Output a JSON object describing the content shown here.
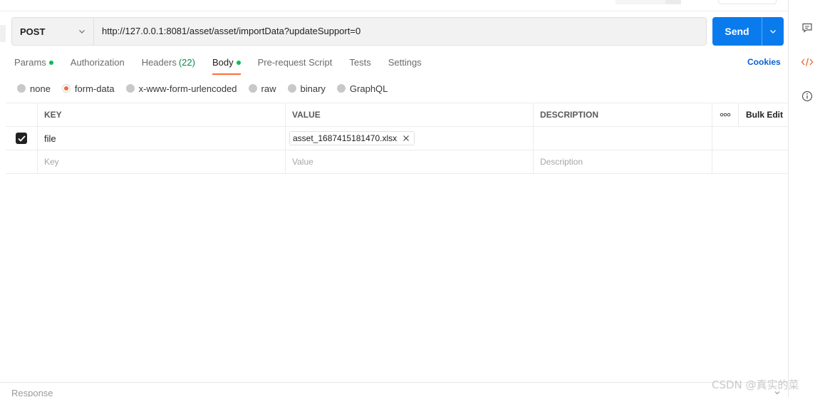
{
  "request": {
    "method": "POST",
    "url": "http://127.0.0.1:8081/asset/asset/importData?updateSupport=0",
    "send_label": "Send"
  },
  "tabs": {
    "items": [
      {
        "label": "Params",
        "dot": true
      },
      {
        "label": "Authorization"
      },
      {
        "label": "Headers",
        "count": "(22)"
      },
      {
        "label": "Body",
        "dot": true,
        "active": true
      },
      {
        "label": "Pre-request Script"
      },
      {
        "label": "Tests"
      },
      {
        "label": "Settings"
      }
    ],
    "cookies_label": "Cookies"
  },
  "body_types": {
    "options": [
      "none",
      "form-data",
      "x-www-form-urlencoded",
      "raw",
      "binary",
      "GraphQL"
    ],
    "selected": "form-data"
  },
  "table": {
    "headers": {
      "key": "KEY",
      "value": "VALUE",
      "description": "DESCRIPTION",
      "bulk_edit": "Bulk Edit"
    },
    "rows": [
      {
        "key": "file",
        "value_file": "asset_1687415181470.xlsx",
        "description": "",
        "checked": true
      }
    ],
    "placeholders": {
      "key": "Key",
      "value": "Value",
      "description": "Description"
    }
  },
  "response": {
    "label": "Response"
  },
  "watermark": "CSDN @真实的菜",
  "colors": {
    "accent": "#ff6c37",
    "send": "#097bed",
    "link": "#0b5fcf",
    "dot": "#0cbb52"
  }
}
